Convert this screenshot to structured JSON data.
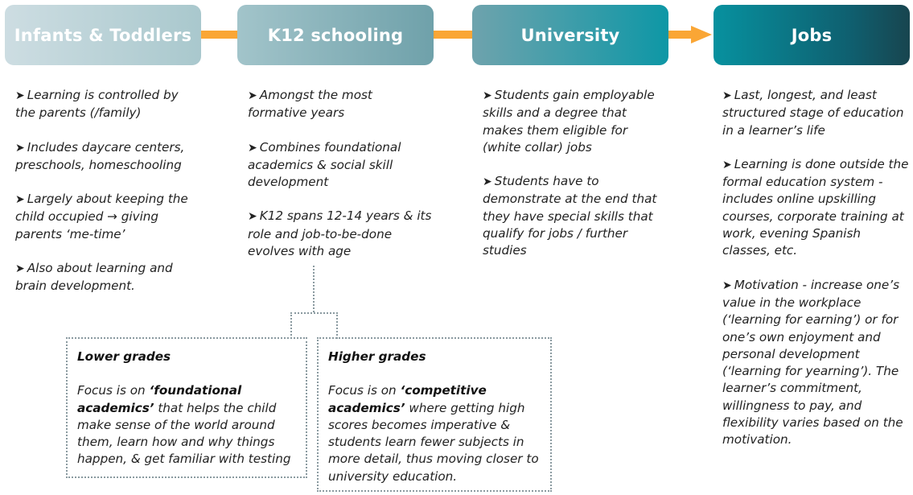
{
  "colors": {
    "connector": "#faa635",
    "stage_gradient": [
      "#cddde2",
      "#a9c8cd",
      "#6fa1aa",
      "#0e97a6",
      "#18454f"
    ],
    "text": "#222222"
  },
  "bullet_icon": "➤",
  "stages": [
    {
      "title": "Infants & Toddlers",
      "points": [
        "Learning is controlled by the parents (/family)",
        "Includes daycare centers, preschools, homeschooling",
        "Largely about keeping the child occupied → giving parents ‘me-time’",
        "Also about learning and brain development."
      ]
    },
    {
      "title": "K12 schooling",
      "points": [
        "Amongst the most formative years",
        "Combines foundational academics & social skill development",
        "K12 spans 12-14 years & its role and job-to-be-done evolves with age"
      ],
      "sub_boxes": [
        {
          "title": "Lower grades",
          "text_before": "Focus is on ",
          "emphasis": "‘foundational academics’",
          "text_after": " that helps the child make sense of the world around them, learn how and why things happen, & get familiar with testing"
        },
        {
          "title": "Higher grades",
          "text_before": "Focus is on ",
          "emphasis": "‘competitive academics’",
          "text_after": " where getting high scores becomes imperative & students learn fewer subjects in more detail, thus moving closer to university education."
        }
      ]
    },
    {
      "title": "University",
      "points": [
        "Students gain employable skills and a degree that makes them eligible for (white collar) jobs",
        "Students have to demonstrate at the end that they have special skills that qualify for jobs / further studies"
      ]
    },
    {
      "title": "Jobs",
      "points": [
        "Last, longest, and least structured stage of education in a learner’s life",
        "Learning is done outside the formal education system - includes online upskilling courses, corporate training at work, evening Spanish classes, etc.",
        "Motivation - increase one’s value in the workplace (‘learning for earning’) or for one’s own enjoyment and personal development (‘learning for yearning’). The learner’s commitment, willingness to pay, and flexibility varies based on the motivation."
      ]
    }
  ]
}
